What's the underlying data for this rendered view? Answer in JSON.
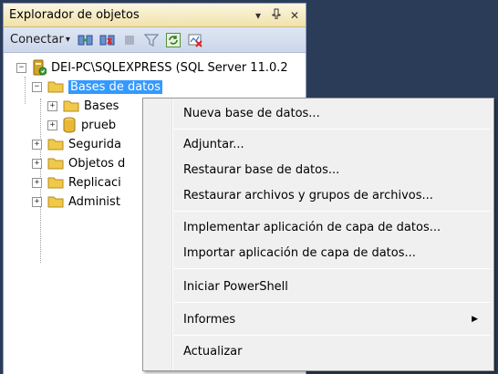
{
  "panel": {
    "title": "Explorador de objetos",
    "pin_glyph": "▾",
    "autohide_glyph": "ᵖ",
    "close_glyph": "✕"
  },
  "toolbar": {
    "connect_label": "Conectar",
    "connect_arrow": "▾",
    "icons": [
      "connect-server-icon",
      "disconnect-icon",
      "stop-icon",
      "filter-icon",
      "refresh-icon",
      "activity-monitor-icon"
    ]
  },
  "tree": {
    "server": "DEI-PC\\SQLEXPRESS (SQL Server 11.0.2",
    "databases": "Bases de datos",
    "system_dbs": "Bases",
    "prueba_db": "prueb",
    "security": "Segurida",
    "server_objects": "Objetos d",
    "replication": "Replicaci",
    "management": "Administ",
    "expanded_glyph": "−",
    "collapsed_glyph": "+"
  },
  "context_menu": {
    "items": [
      "Nueva base de datos...",
      "Adjuntar...",
      "Restaurar base de datos...",
      "Restaurar archivos y grupos de archivos...",
      "Implementar aplicación de capa de datos...",
      "Importar aplicación de capa de datos...",
      "Iniciar PowerShell",
      "Informes",
      "Actualizar"
    ],
    "submenu_arrow": "▶"
  },
  "colors": {
    "background": "#2b3c59",
    "selection": "#3399ff",
    "folder": "#f0c84a"
  }
}
